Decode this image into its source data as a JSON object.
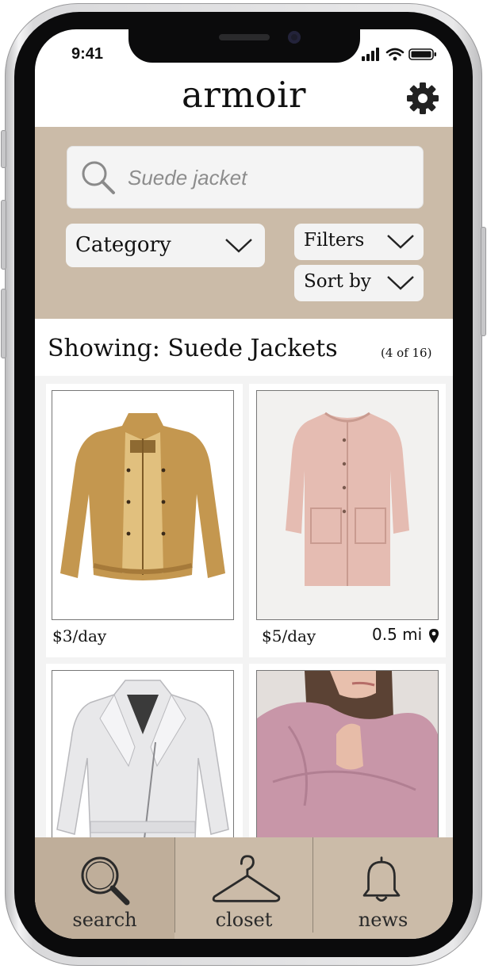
{
  "status_bar": {
    "time": "9:41"
  },
  "header": {
    "title": "armoir",
    "settings_icon": "gear-icon"
  },
  "search": {
    "placeholder": "Suede jacket",
    "category_label": "Category",
    "filters_label": "Filters",
    "sort_label": "Sort by"
  },
  "results": {
    "showing_text": "Showing: Suede Jackets",
    "count_text": "(4 of 16)"
  },
  "items": [
    {
      "price": "$3/day",
      "distance": "",
      "image": "tan-suede-jacket"
    },
    {
      "price": "$5/day",
      "distance": "0.5 mi",
      "image": "pink-suede-coat"
    },
    {
      "price": "",
      "distance": "",
      "image": "white-leather-jacket"
    },
    {
      "price": "",
      "distance": "",
      "image": "mauve-hooded-sweater"
    }
  ],
  "tabs": [
    {
      "label": "search",
      "icon": "search-icon",
      "active": true
    },
    {
      "label": "closet",
      "icon": "hanger-icon",
      "active": false
    },
    {
      "label": "news",
      "icon": "bell-icon",
      "active": false
    }
  ],
  "colors": {
    "accent": "#cbbba8",
    "active_tab": "#bfae9a",
    "panel": "#f3f3f3"
  }
}
